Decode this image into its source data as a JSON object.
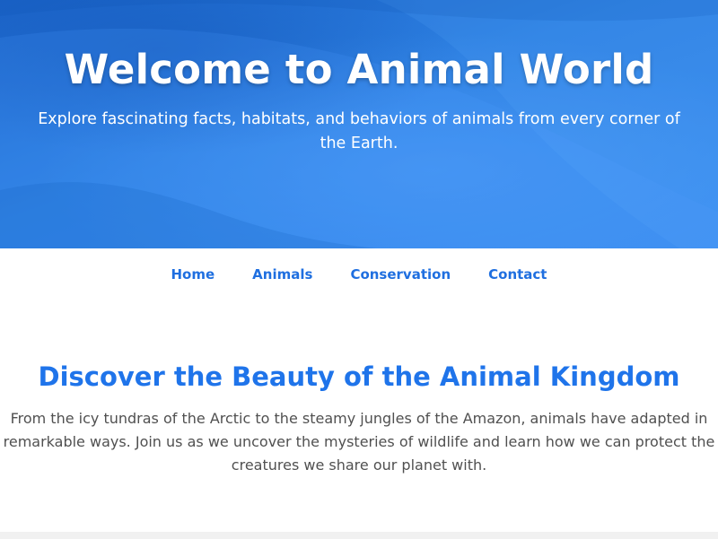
{
  "hero": {
    "title": "Welcome to Animal World",
    "subtitle": "Explore fascinating facts, habitats, and behaviors of animals from every corner of the Earth."
  },
  "nav": {
    "items": [
      {
        "label": "Home"
      },
      {
        "label": "Animals"
      },
      {
        "label": "Conservation"
      },
      {
        "label": "Contact"
      }
    ]
  },
  "intro": {
    "heading": "Discover the Beauty of the Animal Kingdom",
    "text": "From the icy tundras of the Arctic to the steamy jungles of the Amazon, animals have adapted in remarkable ways. Join us as we uncover the mysteries of wildlife and learn how we can protect the creatures we share our planet with."
  },
  "colors": {
    "hero_blue": "#2f7fdc",
    "nav_link": "#1f6fe0",
    "heading_blue": "#1f74ea",
    "body_text": "#505050"
  }
}
